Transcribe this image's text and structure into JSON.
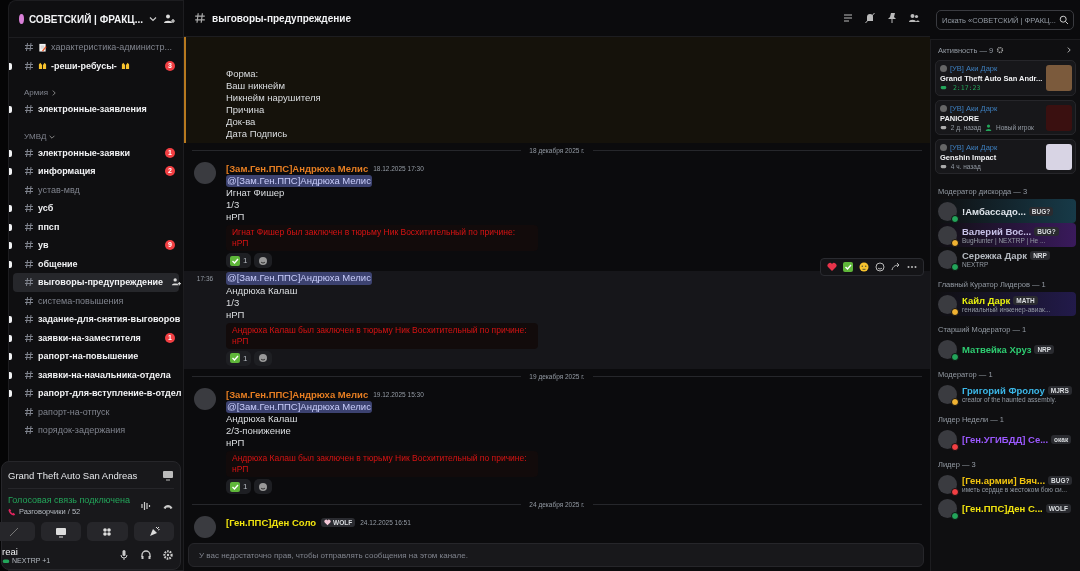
{
  "sidebar": {
    "server_name": "СОВЕТСКИЙ | ФРАКЦ...",
    "channels": [
      {
        "name": "характеристика-администр...",
        "kind": "memo",
        "unread": false,
        "selected": false
      },
      {
        "name": "-реши-ребусы-",
        "kind": "emoji",
        "unread": true,
        "badge": "3",
        "selected": false
      }
    ],
    "categories": [
      {
        "name": "Армия",
        "expanded": false,
        "channels": [
          {
            "name": "электронные-заявления",
            "unread": true,
            "selected": false
          }
        ]
      },
      {
        "name": "УМВД",
        "expanded": true,
        "channels": [
          {
            "name": "электронные-заявки",
            "unread": true,
            "badge": "1",
            "selected": false
          },
          {
            "name": "информация",
            "unread": true,
            "badge": "2",
            "selected": false
          },
          {
            "name": "устав-мвд",
            "unread": false,
            "selected": false
          },
          {
            "name": "усб",
            "unread": true,
            "selected": false
          },
          {
            "name": "ппсп",
            "unread": true,
            "selected": false
          },
          {
            "name": "ув",
            "unread": true,
            "badge": "9",
            "selected": false
          },
          {
            "name": "общение",
            "unread": true,
            "selected": false
          },
          {
            "name": "выговоры-предупреждение",
            "unread": false,
            "selected": true
          },
          {
            "name": "система-повышения",
            "unread": false,
            "selected": false
          },
          {
            "name": "задание-для-снятия-выговоров",
            "unread": true,
            "selected": false
          },
          {
            "name": "заявки-на-заместителя",
            "unread": true,
            "badge": "1",
            "selected": false
          },
          {
            "name": "рапорт-на-повышение",
            "unread": true,
            "selected": false
          },
          {
            "name": "заявки-на-начальника-отдела",
            "unread": true,
            "selected": false
          },
          {
            "name": "рапорт-для-вступление-в-отдел",
            "unread": true,
            "selected": false
          },
          {
            "name": "рапорт-на-отпуск",
            "unread": false,
            "selected": false
          },
          {
            "name": "порядок-задержания",
            "unread": false,
            "selected": false
          }
        ]
      }
    ]
  },
  "voice": {
    "activity": "Grand Theft Auto San Andreas",
    "status": "Голосовая связь подключена",
    "channel": "Разговорчики / 52"
  },
  "user": {
    "name": "reai",
    "status": "NEXTRP +1"
  },
  "chat": {
    "channel": "выговоры-предупреждение",
    "messages": [
      {
        "kind": "continuation",
        "highlighted": true,
        "hovered": false,
        "lines": [
          "Форма:",
          "Ваш никнейм",
          "Никнейм нарушителя",
          "Причина",
          "Док-ва",
          "Дата Подпись"
        ]
      },
      {
        "kind": "divider",
        "label": "18 декабря 2025 г."
      },
      {
        "kind": "message",
        "highlighted": false,
        "hovered": false,
        "author": "[Зам.Ген.ППС]Андрюха Мелис",
        "color": "#e67e22",
        "time": "18.12.2025 17:30",
        "mention": "@[Зам.Ген.ППС]Андрюха Мелис",
        "lines": [
          "Игнат Фишер",
          "1/3",
          "нРП"
        ],
        "embed": "Игнат Фишер был заключен в тюрьму Ник Восхитительный по причине: нРП",
        "reactions": [
          {
            "kind": "check",
            "count": "1"
          }
        ]
      },
      {
        "kind": "continuation",
        "highlighted": false,
        "hovered": true,
        "time": "17:36",
        "mention": "@[Зам.Ген.ППС]Андрюха Мелис",
        "lines": [
          "Андрюха Калаш",
          "1/3",
          "нРП"
        ],
        "embed": "Андрюха Калаш был заключен в тюрьму Ник Восхитительный по причине: нРП",
        "reactions": [
          {
            "kind": "check",
            "count": "1"
          }
        ]
      },
      {
        "kind": "divider",
        "label": "19 декабря 2025 г."
      },
      {
        "kind": "message",
        "highlighted": false,
        "hovered": false,
        "author": "[Зам.Ген.ППС]Андрюха Мелис",
        "color": "#e67e22",
        "time": "19.12.2025 15:30",
        "mention": "@[Зам.Ген.ППС]Андрюха Мелис",
        "lines": [
          "Андрюха Калаш",
          "2/3-понижение",
          "нРП"
        ],
        "embed": "Андрюха Калаш был заключен в тюрьму Ник Восхитительный по причине: нРП",
        "reactions": [
          {
            "kind": "check",
            "count": "1"
          }
        ]
      },
      {
        "kind": "divider",
        "label": "24 декабря 2025 г."
      },
      {
        "kind": "message",
        "highlighted": false,
        "hovered": false,
        "author": "[Ген.ППС]Ден Соло",
        "color": "#f1e40f",
        "tag": "WOLF",
        "time": "24.12.2025 16:51"
      }
    ],
    "input_placeholder": "У вас недостаточно прав, чтобы отправлять сообщения на этом канале."
  },
  "members_panel": {
    "search_placeholder": "Искать «СОВЕТСКИЙ | ФРАКЦ...",
    "activity_heading": "Активность — 9",
    "activities": [
      {
        "user": "[УВ] Аки Дарк",
        "game": "Grand Theft Auto San Andr...",
        "details": [
          {
            "kind": "timer",
            "text": "2:17:23"
          }
        ]
      },
      {
        "user": "[УВ] Аки Дарк",
        "game": "PANICORE",
        "details": [
          {
            "kind": "played",
            "text": "2 д. назад"
          },
          {
            "kind": "new",
            "text": "Новый игрок"
          }
        ]
      },
      {
        "user": "[УВ] Аки Дарк",
        "game": "Genshin Impact",
        "details": [
          {
            "kind": "played",
            "text": "4 ч. назад"
          }
        ]
      }
    ],
    "groups": [
      {
        "heading": "Модератор дискорда — 3",
        "members": [
          {
            "name": "!Амбассадо...",
            "color": "#dfe3ea",
            "status_dot": {
              "color": "#23a55a"
            },
            "tag": "BUG?",
            "banner": {
              "color": "#173a48"
            }
          },
          {
            "name": "Валерий Вос...",
            "color": "#c8c2e8",
            "status_dot": {
              "color": "#f0b232"
            },
            "tag": "BUG?",
            "activity": "BugHunter | NEXTRP | He ...",
            "banner": {
              "color": "#3a1a5c"
            }
          },
          {
            "name": "Сережка Дарк",
            "color": "#b5bac1",
            "status_dot": {
              "color": "#23a55a"
            },
            "tag": "NRP",
            "activity": "NEXTRP"
          }
        ]
      },
      {
        "heading": "Главный Куратор Лидеров — 1",
        "members": [
          {
            "name": "Кайл Дарк",
            "color": "#e8f00f",
            "status_dot": {
              "color": "#f0b232"
            },
            "tag": "MATH",
            "activity": "гениальный инженер-авиак...",
            "banner": {
              "color": "#221a4a"
            }
          }
        ]
      },
      {
        "heading": "Старший Модератор — 1",
        "members": [
          {
            "name": "Матвейка Хруз",
            "color": "#2ecc71",
            "status_dot": {
              "color": "#23a55a"
            },
            "tag": "NRP"
          }
        ]
      },
      {
        "heading": "Модератор — 1",
        "members": [
          {
            "name": "Григорий Фролоу",
            "color": "#3bb6e6",
            "status_dot": {
              "color": "#f0b232"
            },
            "tag": "MJRS",
            "activity": "creator of the haunted assembly."
          }
        ]
      },
      {
        "heading": "Лидер Недели — 1",
        "members": [
          {
            "name": "[Ген.УГИБДД] Се...",
            "color": "#9b59ff",
            "status_dot": {
              "color": "#f23f43"
            },
            "tag": "окак"
          }
        ]
      },
      {
        "heading": "Лидер — 3",
        "members": [
          {
            "name": "[Ген.армии] Вяч...",
            "color": "#f1c40f",
            "status_dot": {
              "color": "#f23f43"
            },
            "tag": "BUG?",
            "activity": "иметь сердце в жестоком бою си..."
          },
          {
            "name": "[Ген.ППС]Ден С...",
            "color": "#f1e40f",
            "status_dot": {
              "color": "#23a55a"
            },
            "tag": "WOLF"
          }
        ]
      }
    ]
  }
}
